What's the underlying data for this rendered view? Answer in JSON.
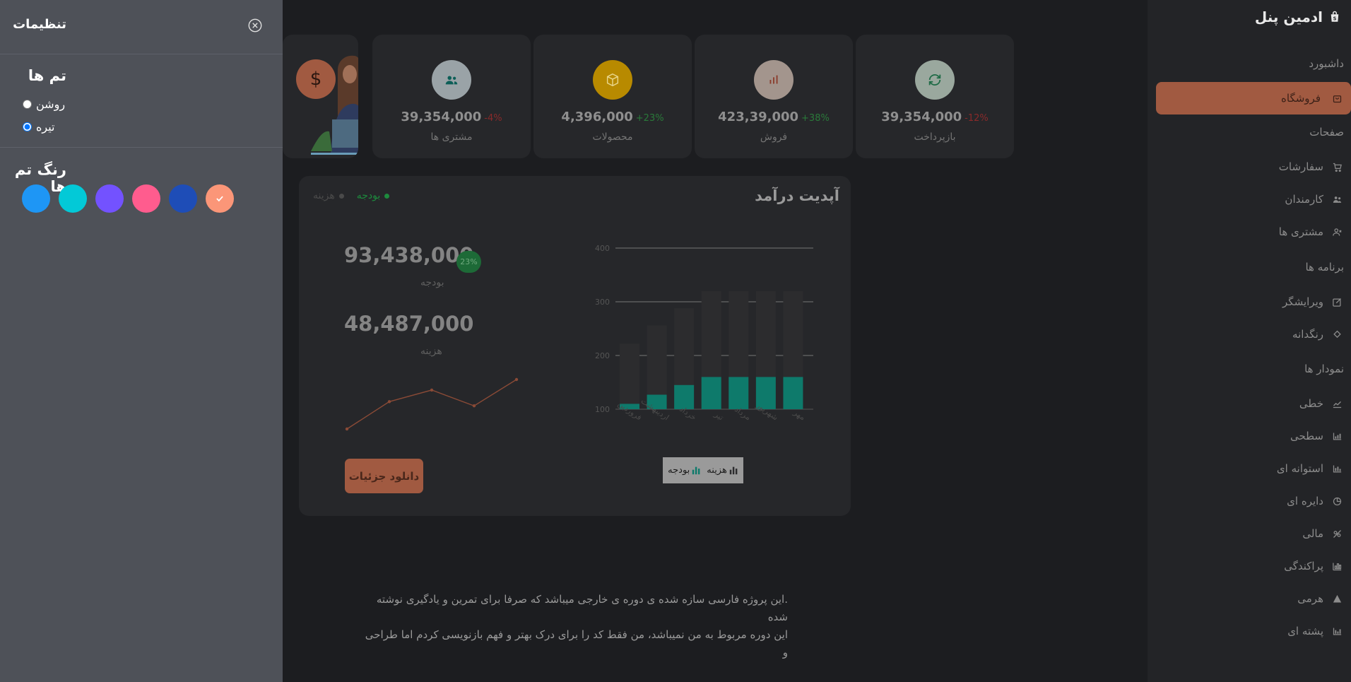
{
  "sidebar": {
    "brand": "ادمین پنل",
    "dashboard_section": "داشبورد",
    "shop": "فروشگاه",
    "pages_section": "صفحات",
    "orders": "سفارشات",
    "employees": "کارمندان",
    "customers": "مشتری ها",
    "apps_section": "برنامه ها",
    "editor": "ویرایشگر",
    "color_picker": "رنگدانه",
    "charts_section": "نمودار ها",
    "line": "خطی",
    "area": "سطحی",
    "bar": "استوانه ای",
    "pie": "دایره ای",
    "financial": "مالی",
    "scatter": "پراکندگی",
    "pyramid": "هرمی",
    "stacked": "پشته ای"
  },
  "stats": [
    {
      "value": "39,354,000",
      "change": "-4%",
      "label": "مشتری ها",
      "color": "#9aa3a7",
      "icon": "users-icon"
    },
    {
      "value": "4,396,000",
      "change": "+23%",
      "label": "محصولات",
      "color": "#b88a00",
      "icon": "box-icon"
    },
    {
      "value": "423,39,000",
      "change": "+38%",
      "label": "فروش",
      "color": "#a3958d",
      "icon": "bar-chart-icon"
    },
    {
      "value": "39,354,000",
      "change": "-12%",
      "label": "بازپرداخت",
      "color": "#9aa89e",
      "icon": "refresh-icon"
    }
  ],
  "welcome": {
    "dollar": "$"
  },
  "revenue": {
    "title": "آپدیت درآمد",
    "legend_expense": "هزینه",
    "legend_budget": "بودجه",
    "budget_value": "93,438,000",
    "budget_badge": "23%",
    "budget_label": "بودجه",
    "expense_value": "48,487,000",
    "expense_label": "هزینه",
    "download": "دانلود جزئیات",
    "chart_legend_expense": "هزینه",
    "chart_legend_budget": "بودجه"
  },
  "chart_data": {
    "type": "bar",
    "categories": [
      "فروردین",
      "اردیبهشت",
      "خرداد",
      "تیر",
      "مرداد",
      "شهریور",
      "مهر"
    ],
    "series": [
      {
        "name": "بودجه",
        "values": [
          110,
          127,
          145,
          160,
          160,
          160,
          160
        ],
        "color": "#0e7a6b"
      },
      {
        "name": "هزینه",
        "values": [
          222,
          256,
          288,
          320,
          320,
          320,
          320
        ],
        "color": "#2c2c2e"
      }
    ],
    "yticks": [
      100,
      200,
      300,
      400
    ],
    "ylim": [
      100,
      400
    ],
    "sparkline": [
      0,
      26,
      37,
      22,
      47
    ]
  },
  "footer": {
    "line1": ".این پروژه فارسی سازه شده ی دوره ی خارجی میباشد که صرفا برای تمرین و یادگیری نوشته شده",
    "line2": "این دوره مربوط به من نمیباشد، من فقط کد را برای درک بهتر و فهم بازنویسی کردم اما طراحی و"
  },
  "settings": {
    "title": "تنظیمات",
    "themes_heading": "تم ها",
    "light": "روشن",
    "dark": "تیره",
    "selected_theme": "dark",
    "colors_heading": "رنگ تم ها",
    "swatches": [
      "#1e96f5",
      "#03c9d7",
      "#7352ff",
      "#ff5c8e",
      "#1e4db7",
      "#fb9678"
    ],
    "selected_swatch": 5
  }
}
